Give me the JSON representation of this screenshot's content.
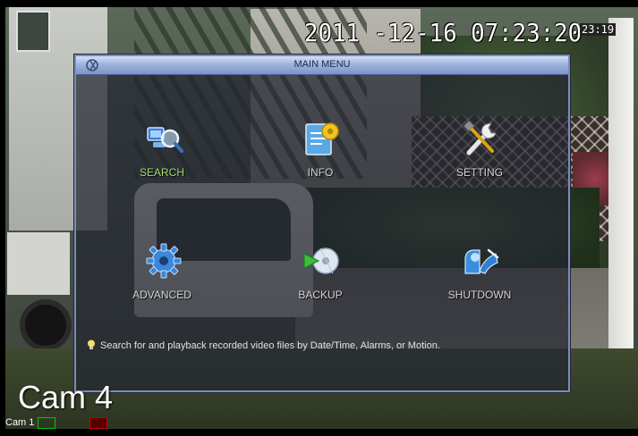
{
  "osd": {
    "timestamp": "2011 -12-16  07:23:20",
    "clock_small": "23:19",
    "camera_name": "Cam 4",
    "status_label": "Cam 1"
  },
  "menu": {
    "title": "MAIN MENU",
    "items": [
      {
        "label": "SEARCH",
        "icon": "search-icon",
        "active": true
      },
      {
        "label": "INFO",
        "icon": "info-icon",
        "active": false
      },
      {
        "label": "SETTING",
        "icon": "setting-icon",
        "active": false
      },
      {
        "label": "ADVANCED",
        "icon": "advanced-gear-icon",
        "active": false
      },
      {
        "label": "BACKUP",
        "icon": "backup-icon",
        "active": false
      },
      {
        "label": "SHUTDOWN",
        "icon": "shutdown-icon",
        "active": false
      }
    ],
    "hint": "Search for and playback recorded video files by Date/Time, Alarms, or Motion."
  },
  "colors": {
    "active_label": "#9fe06a",
    "titlebar": "#9fb3dc",
    "menu_border": "#7a8db5"
  }
}
